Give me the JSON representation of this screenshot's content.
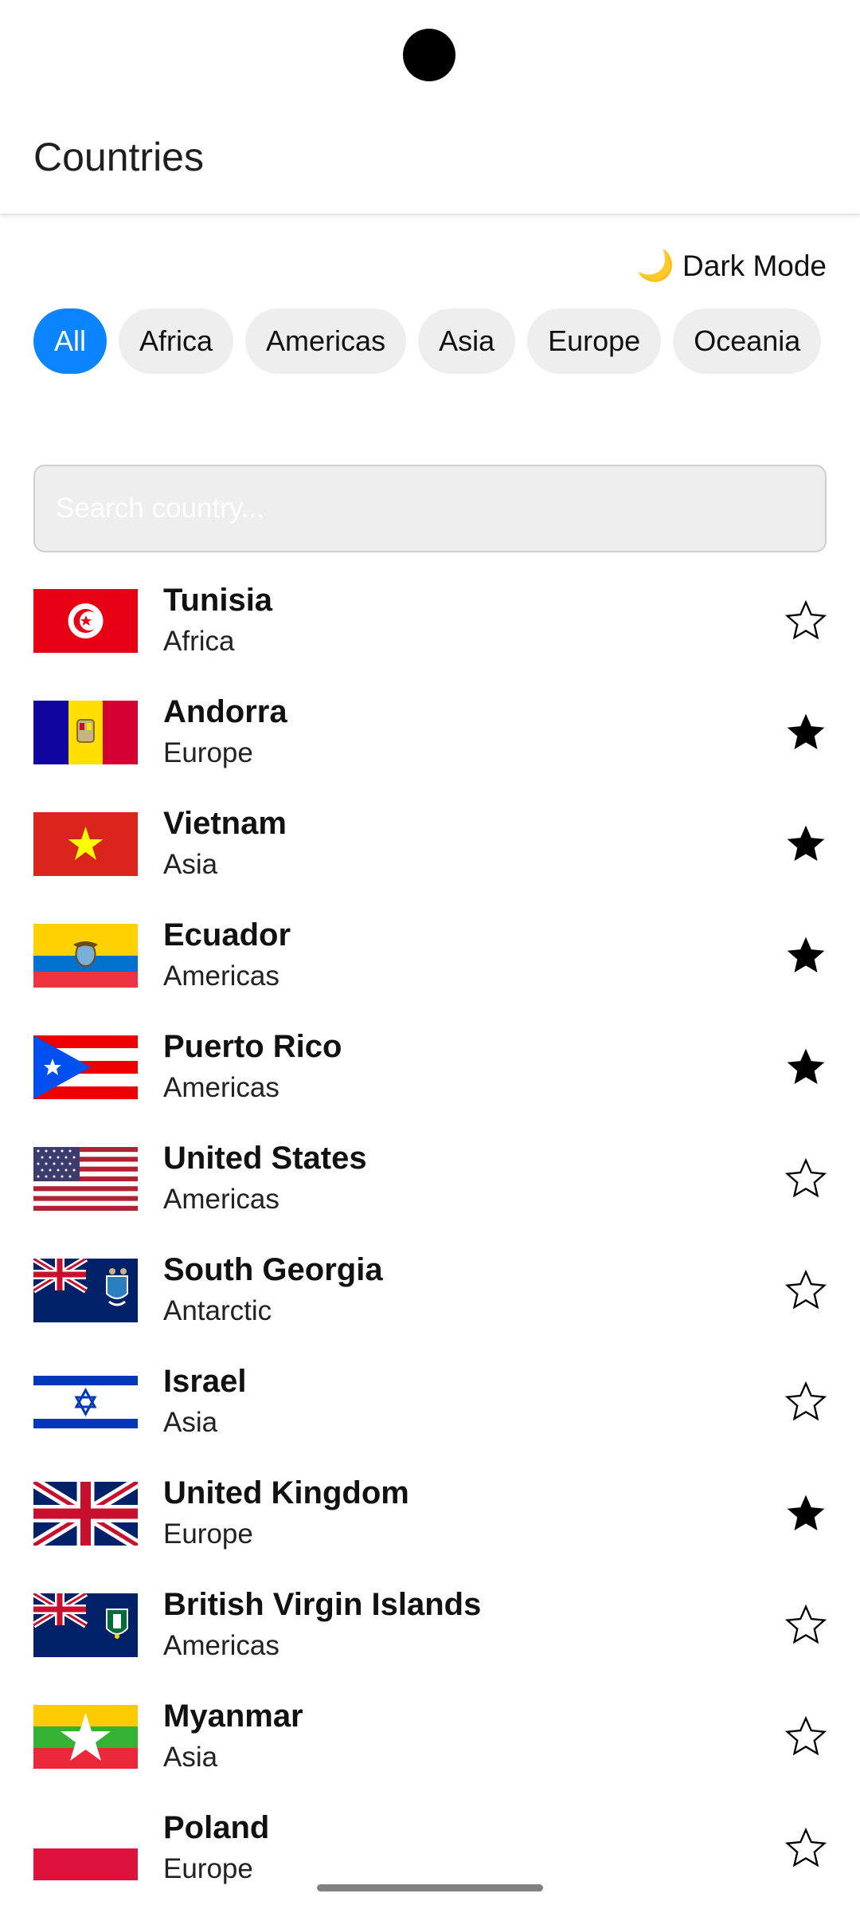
{
  "app": {
    "title": "Countries",
    "dark_mode_label": "Dark Mode"
  },
  "filters": [
    "All",
    "Africa",
    "Americas",
    "Asia",
    "Europe",
    "Oceania"
  ],
  "active_filter": "All",
  "search": {
    "placeholder": "Search country..."
  },
  "countries": [
    {
      "name": "Tunisia",
      "region": "Africa",
      "favorite": false,
      "flag": "tunisia-flag-icon"
    },
    {
      "name": "Andorra",
      "region": "Europe",
      "favorite": true,
      "flag": "andorra-flag-icon"
    },
    {
      "name": "Vietnam",
      "region": "Asia",
      "favorite": true,
      "flag": "vietnam-flag-icon"
    },
    {
      "name": "Ecuador",
      "region": "Americas",
      "favorite": true,
      "flag": "ecuador-flag-icon"
    },
    {
      "name": "Puerto Rico",
      "region": "Americas",
      "favorite": true,
      "flag": "puerto-rico-flag-icon"
    },
    {
      "name": "United States",
      "region": "Americas",
      "favorite": false,
      "flag": "united-states-flag-icon"
    },
    {
      "name": "South Georgia",
      "region": "Antarctic",
      "favorite": false,
      "flag": "south-georgia-flag-icon"
    },
    {
      "name": "Israel",
      "region": "Asia",
      "favorite": false,
      "flag": "israel-flag-icon"
    },
    {
      "name": "United Kingdom",
      "region": "Europe",
      "favorite": true,
      "flag": "united-kingdom-flag-icon"
    },
    {
      "name": "British Virgin Islands",
      "region": "Americas",
      "favorite": false,
      "flag": "british-virgin-islands-flag-icon"
    },
    {
      "name": "Myanmar",
      "region": "Asia",
      "favorite": false,
      "flag": "myanmar-flag-icon"
    },
    {
      "name": "Poland",
      "region": "Europe",
      "favorite": false,
      "flag": "poland-flag-icon"
    }
  ],
  "colors": {
    "accent": "#0a84ff",
    "chip_bg": "#eeeeee",
    "search_bg": "#eeeeee"
  }
}
